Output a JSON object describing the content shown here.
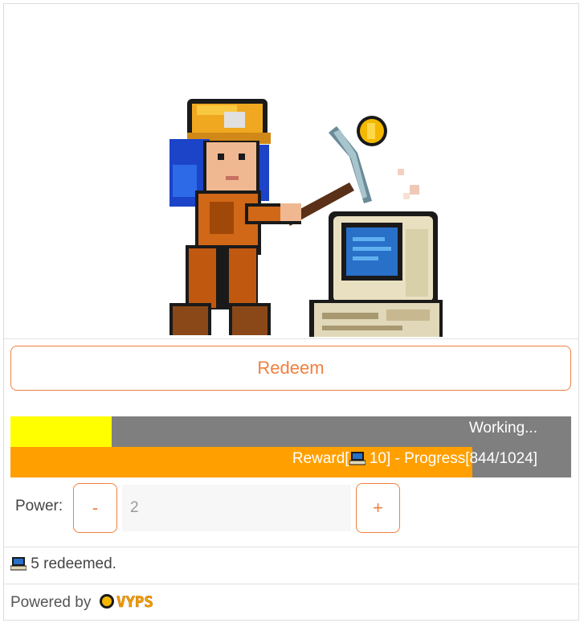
{
  "redeem": {
    "label": "Redeem"
  },
  "work_bar": {
    "status": "Working...",
    "progress": 0.18,
    "color": "#ffff00"
  },
  "reward_bar": {
    "reward_prefix": "Reward[",
    "reward_amount": "10",
    "progress_label": "] - Progress[844/1024]",
    "progress_current": 844,
    "progress_total": 1024,
    "color": "#ffa000"
  },
  "power": {
    "label": "Power:",
    "decrement": "-",
    "value": "2",
    "increment": "+"
  },
  "redeemed": {
    "text": "5 redeemed."
  },
  "footer": {
    "powered_by": "Powered by",
    "brand": "VYPS"
  },
  "icons": {
    "reward": "computer-icon",
    "brand": "vyps-logo"
  },
  "colors": {
    "accent": "#f08040",
    "bar_bg": "#7f7f7f"
  }
}
